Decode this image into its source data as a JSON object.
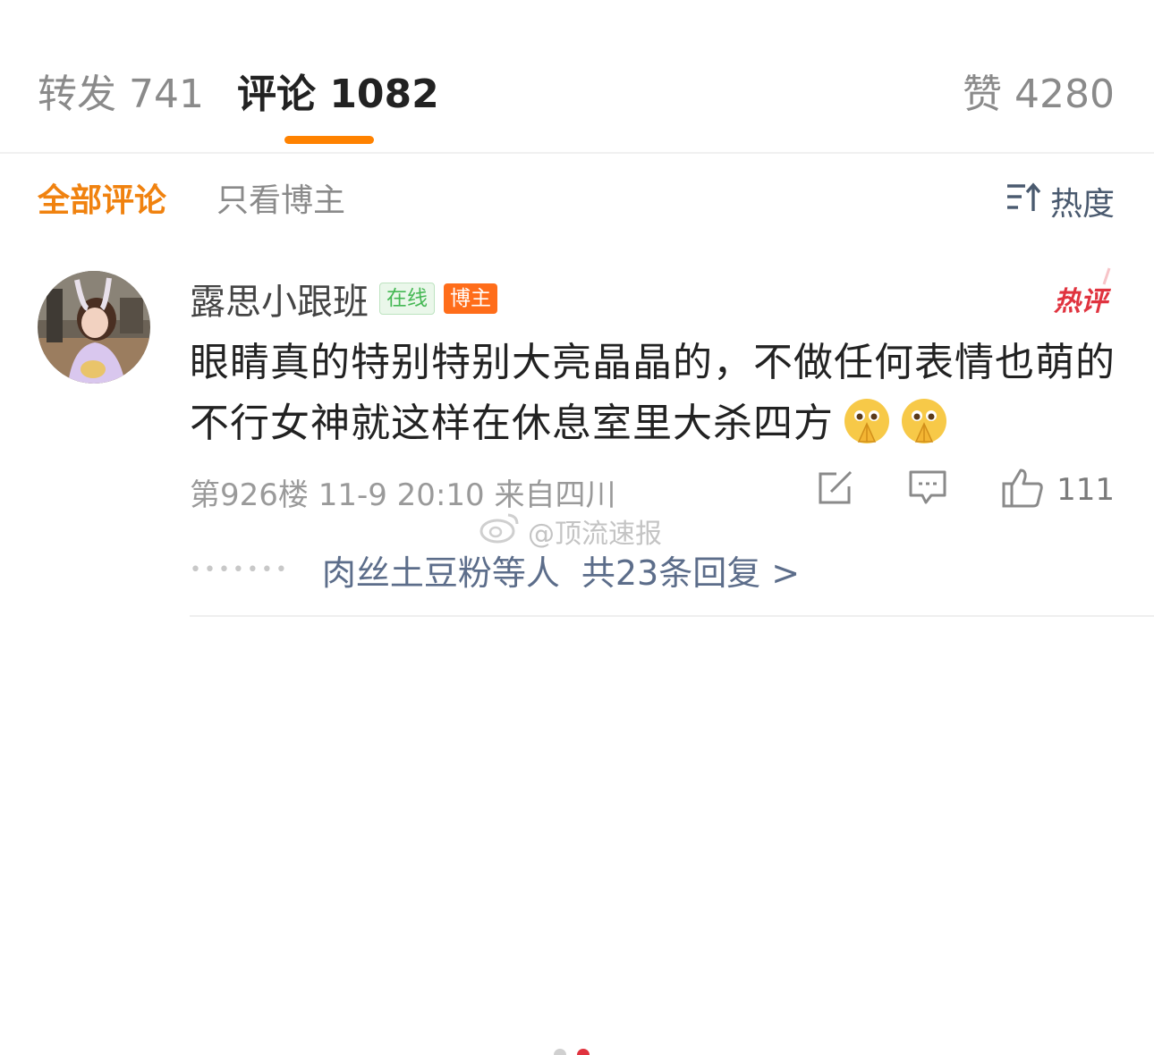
{
  "tabs": {
    "forward": "转发 741",
    "comment": "评论 1082",
    "like": "赞 4280"
  },
  "filters": {
    "all": "全部评论",
    "owner_only": "只看博主",
    "sort": "热度"
  },
  "comment": {
    "username": "露思小跟班",
    "badge_online": "在线",
    "badge_owner": "博主",
    "hot_label": "热评",
    "text": "眼睛真的特别特别大亮晶晶的，不做任何表情也萌的不行女神就这样在休息室里大杀四方",
    "emojis": [
      "pray-emoji",
      "pray-emoji"
    ],
    "meta": "第926楼 11-9 20:10 来自四川",
    "like_count": "111",
    "replies": {
      "users": "肉丝土豆粉等人",
      "count": "共23条回复 >"
    }
  },
  "watermark": "@顶流速报",
  "colors": {
    "accent": "#ff8200",
    "active_filter": "#f0820f",
    "hot": "#e0333f",
    "reply_link": "#5c6d8a"
  },
  "icons": [
    "sort-icon",
    "share-icon",
    "comment-icon",
    "like-icon",
    "weibo-logo-icon"
  ]
}
